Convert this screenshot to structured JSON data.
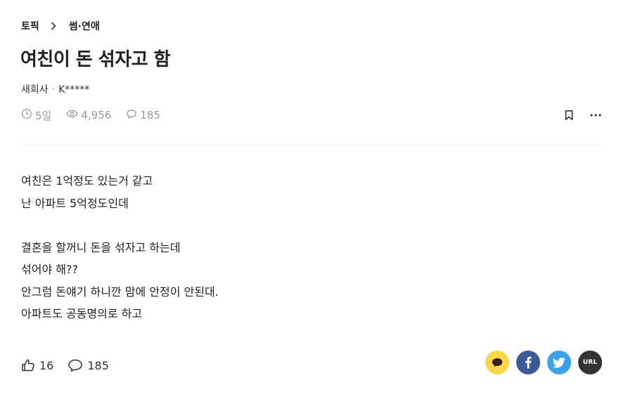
{
  "breadcrumb": {
    "root": "토픽",
    "current": "썸·연애"
  },
  "post": {
    "title": "여친이 돈 섞자고 함",
    "author_company": "새회사",
    "author_separator": "·",
    "author_name": "K*****",
    "time_ago": "5일",
    "views": "4,956",
    "comments": "185",
    "body_lines": [
      "여친은 1억정도 있는거 같고",
      "난 아파트 5억정도인데",
      "",
      "결혼을 할꺼니 돈을 섞자고 하는데",
      "섞어야 해??",
      "안그럼 돈얘기 하니깐 맘에 안정이 안된대.",
      "아파트도 공동명의로 하고"
    ]
  },
  "footer": {
    "likes": "16",
    "comments": "185",
    "share_url_label": "URL"
  },
  "icons": {
    "chevron": "chevron-right-icon",
    "clock": "clock-icon",
    "eye": "eye-icon",
    "comment": "comment-icon",
    "bookmark": "bookmark-icon",
    "more": "more-icon",
    "like": "thumbs-up-icon",
    "kakao": "kakaotalk-icon",
    "facebook": "facebook-icon",
    "twitter": "twitter-icon"
  },
  "colors": {
    "meta_gray": "#9a9a9a",
    "kakao": "#f9d84a",
    "facebook": "#3b5a9a",
    "twitter": "#3aa1eb",
    "url": "#333333"
  }
}
